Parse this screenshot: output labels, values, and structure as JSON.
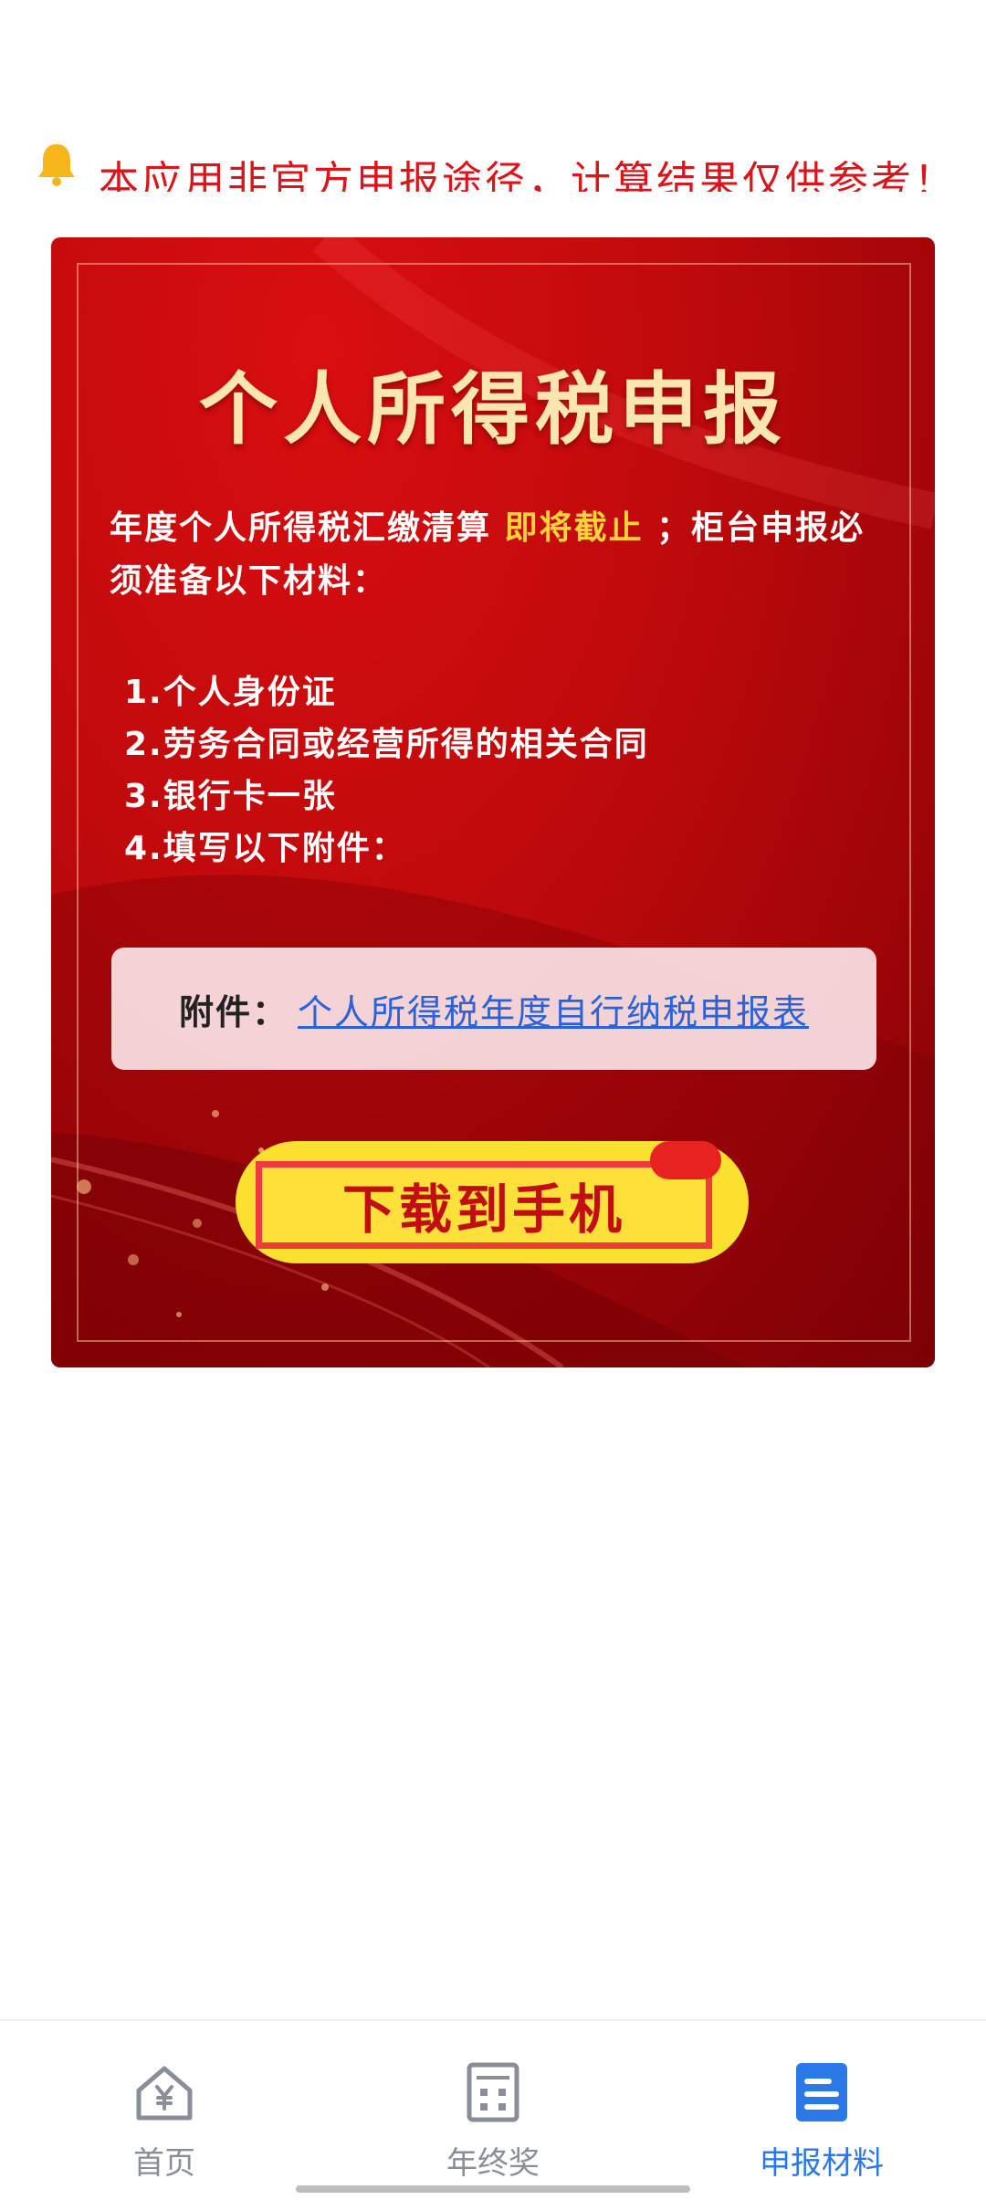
{
  "notice": {
    "icon": "bell-icon",
    "text": "本应用非官方申报途径，计算结果仅供参考！"
  },
  "poster": {
    "title": "个人所得税申报",
    "para_prefix": "年度个人所得税汇缴清算",
    "para_highlight": "即将截止",
    "para_suffix": "；柜台申报必须准备以下材料：",
    "items": [
      "1.个人身份证",
      "2.劳务合同或经营所得的相关合同",
      "3.银行卡一张",
      "4.填写以下附件："
    ],
    "attachment_label": "附件：",
    "attachment_link": "个人所得税年度自行纳税申报表",
    "download_label": "下载到手机",
    "colors": {
      "primary_red": "#c10a0c",
      "highlight": "#ffd43a",
      "link": "#2a62d8",
      "button": "#fbe02f"
    }
  },
  "nav": {
    "items": [
      {
        "label": "首页",
        "icon": "home-yuan-icon",
        "active": false
      },
      {
        "label": "年终奖",
        "icon": "calculator-icon",
        "active": false
      },
      {
        "label": "申报材料",
        "icon": "document-icon",
        "active": true
      }
    ],
    "colors": {
      "active": "#2b79e8",
      "inactive": "#8a8e99"
    }
  }
}
